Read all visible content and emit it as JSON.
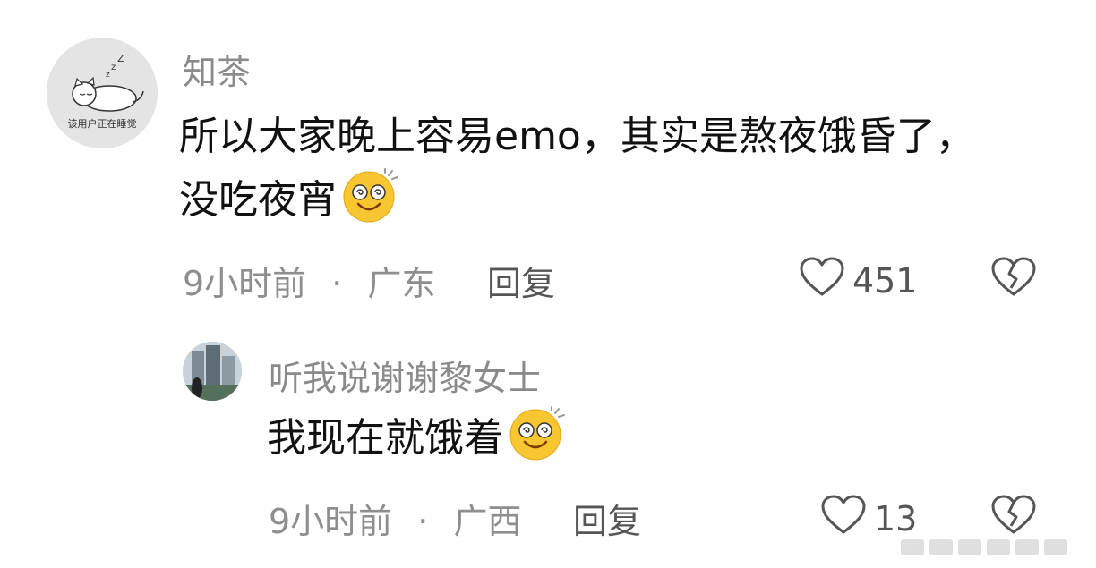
{
  "comments": [
    {
      "username": "知茶",
      "avatar_caption": "该用户正在睡觉",
      "content": "所以大家晚上容易emo，其实是熬夜饿昏了，没吃夜宵",
      "emoji": "dizzy-smile-emoji",
      "time": "9小时前",
      "location": "广东",
      "reply_label": "回复",
      "like_count": "451"
    },
    {
      "username": "听我说谢谢黎女士",
      "content": "我现在就饿着",
      "emoji": "dizzy-smile-emoji",
      "time": "9小时前",
      "location": "广西",
      "reply_label": "回复",
      "like_count": "13"
    }
  ],
  "meta_separator": "·",
  "icons": {
    "like": "heart-outline-icon",
    "dislike": "broken-heart-icon"
  },
  "colors": {
    "username": "#8a8a8a",
    "meta": "#8e8e8e",
    "text": "#111111",
    "emoji_face": "#f7c631"
  }
}
